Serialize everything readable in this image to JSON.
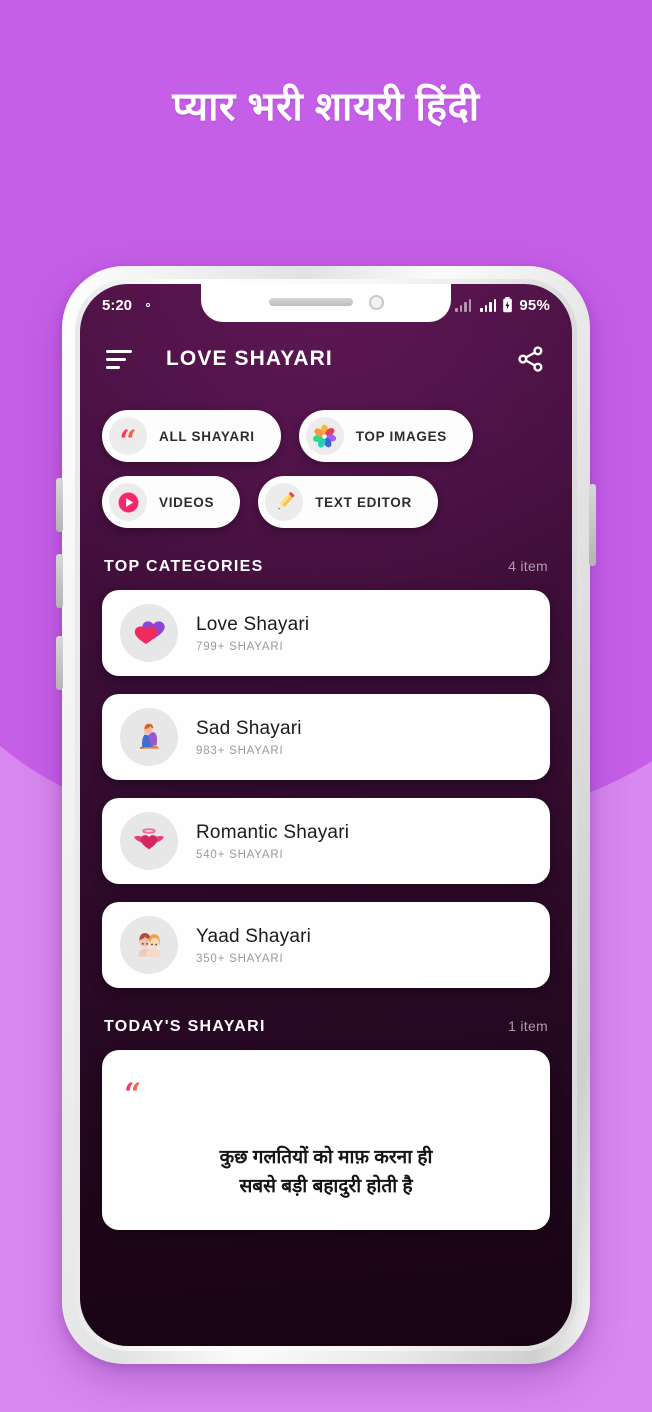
{
  "page": {
    "title": "प्यार भरी शायरी हिंदी",
    "bg_top_color": "#c65fe8",
    "bg_bottom_color": "#d888ee"
  },
  "status_bar": {
    "time": "5:20",
    "gear_icon": "gear-icon",
    "signal_icon": "signal-bars-icon",
    "battery_icon": "battery-icon",
    "battery_percent": "95%"
  },
  "app_bar": {
    "menu_icon": "hamburger-menu-icon",
    "title": "LOVE SHAYARI",
    "share_icon": "share-icon"
  },
  "chips": [
    {
      "label": "ALL SHAYARI",
      "icon": "quote-icon"
    },
    {
      "label": "TOP IMAGES",
      "icon": "photos-flower-icon"
    },
    {
      "label": "VIDEOS",
      "icon": "play-circle-icon"
    },
    {
      "label": "TEXT EDITOR",
      "icon": "pencil-icon"
    }
  ],
  "top_categories": {
    "title": "TOP CATEGORIES",
    "count": "4 item",
    "items": [
      {
        "name": "Love Shayari",
        "sub": "799+ SHAYARI",
        "icon": "two-hearts-icon"
      },
      {
        "name": "Sad Shayari",
        "sub": "983+ SHAYARI",
        "icon": "sad-person-icon"
      },
      {
        "name": "Romantic Shayari",
        "sub": "540+ SHAYARI",
        "icon": "winged-heart-icon"
      },
      {
        "name": "Yaad Shayari",
        "sub": "350+ SHAYARI",
        "icon": "couple-hug-icon"
      }
    ]
  },
  "todays_shayari": {
    "title": "TODAY'S SHAYARI",
    "count": "1 item",
    "quote_icon": "quote-icon",
    "line1": "कुछ गलतियों को माफ़ करना ही",
    "line2": "सबसे बड़ी बहादुरी होती है"
  },
  "colors": {
    "accent_pink": "#f0246e",
    "accent_orange": "#fb7b3a",
    "screen_top": "#4a1142",
    "screen_bottom": "#170413"
  }
}
